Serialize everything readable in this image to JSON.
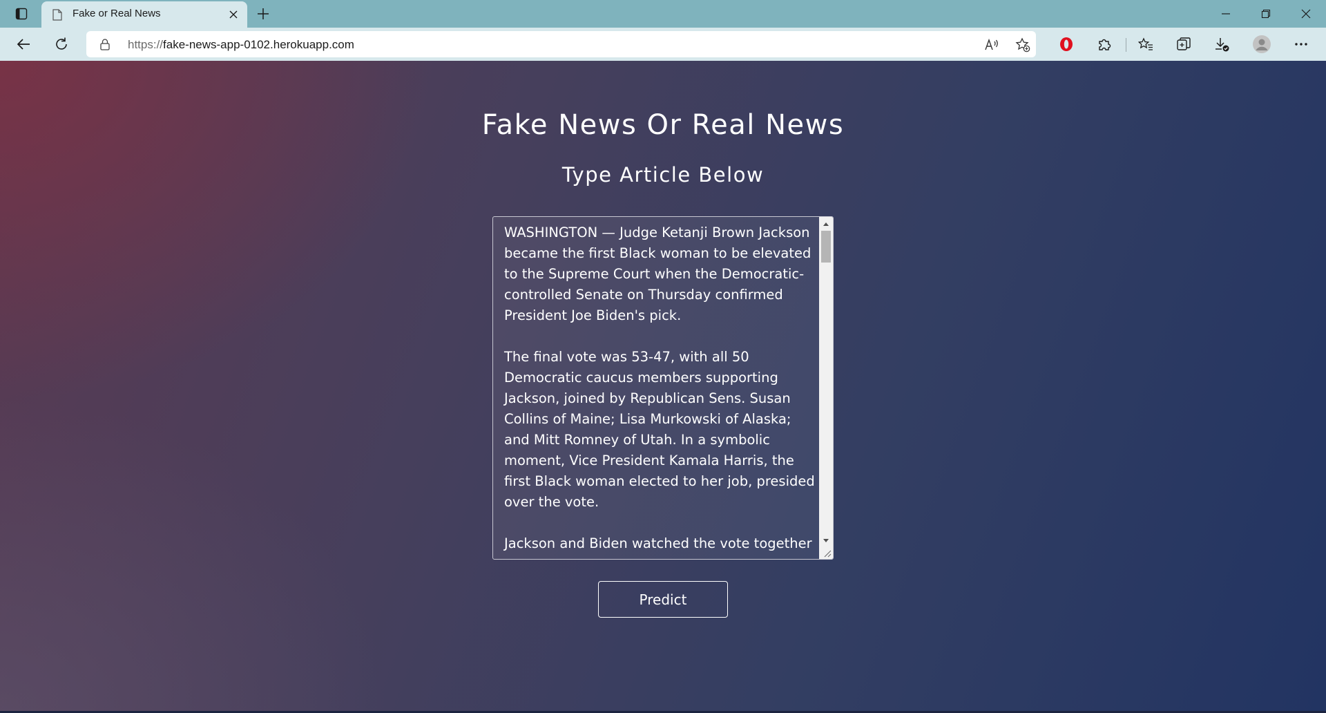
{
  "browser": {
    "tab_title": "Fake or Real News",
    "url_scheme": "https://",
    "url_host": "fake-news-app-0102.herokuapp.com"
  },
  "page": {
    "title": "Fake News Or Real News",
    "subtitle": "Type Article Below",
    "article_text": "WASHINGTON — Judge Ketanji Brown Jackson became the first Black woman to be elevated to the Supreme Court when the Democratic-controlled Senate on Thursday confirmed President Joe Biden's pick.\n\nThe final vote was 53-47, with all 50 Democratic caucus members supporting Jackson, joined by Republican Sens. Susan Collins of Maine; Lisa Murkowski of Alaska; and Mitt Romney of Utah. In a symbolic moment, Vice President Kamala Harris, the first Black woman elected to her job, presided over the vote.\n\nJackson and Biden watched the vote together",
    "predict_label": "Predict"
  },
  "colors": {
    "tabstrip": "#7fb3bd",
    "toolbar": "#d7e8ec",
    "bg_left": "#823042",
    "bg_right": "#223462",
    "text": "#ffffff",
    "opera_red": "#e0101e"
  },
  "icons": {
    "tab_actions": "tab-actions-icon",
    "favicon": "page-icon",
    "close": "close-icon",
    "new_tab": "plus-icon",
    "back": "back-arrow-icon",
    "refresh": "refresh-icon",
    "lock": "lock-icon",
    "read_aloud": "read-aloud-icon",
    "add_favorite": "add-favorite-icon",
    "opera": "opera-icon",
    "extensions": "puzzle-icon",
    "favorites": "favorites-icon",
    "collections": "collections-icon",
    "downloads": "download-icon",
    "profile": "avatar",
    "menu": "more-icon"
  }
}
